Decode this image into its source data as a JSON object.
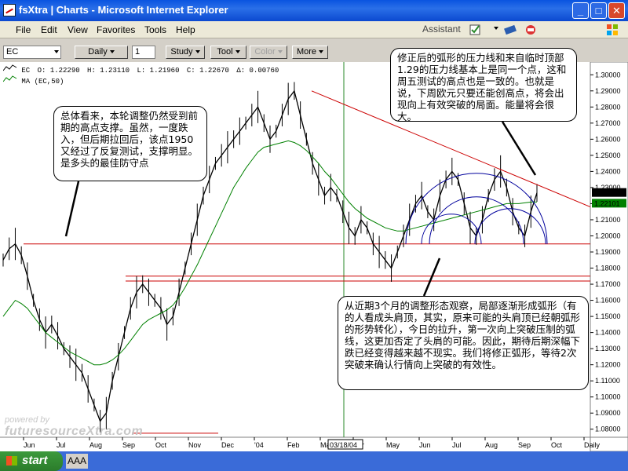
{
  "window": {
    "title": "fsXtra | Charts - Microsoft Internet Explorer",
    "controls": {
      "minimize": "_",
      "maximize": "□",
      "close": "✕"
    }
  },
  "menu": {
    "items": [
      "File",
      "Edit",
      "View",
      "Favorites",
      "Tools",
      "Help"
    ],
    "assistant": "Assistant"
  },
  "toolbar": {
    "symbol": "EC",
    "period": "Daily",
    "count": "1",
    "study": "Study",
    "tool": "Tool",
    "color": "Color",
    "more": "More"
  },
  "legend": {
    "row1": {
      "symbol": "EC",
      "open": "O: 1.22290",
      "high": "H: 1.23110",
      "low": "L: 1.21960",
      "close": "C: 1.22670",
      "change": "Δ: 0.00760"
    },
    "row2": {
      "label": "MA (EC,50)"
    }
  },
  "watermark": {
    "line1": "powered by",
    "line2": "futuresourceXtra.com"
  },
  "annotations": {
    "top_right": "修正后的弧形的压力线和来自临时顶部1.29的压力线基本上是同一个点，这和周五测试的高点也是一致的。也就是说，下周欧元只要还能创高点，将会出现向上有效突破的局面。能量将会很大。",
    "left": "总体看来，本轮调整仍然受到前期的高点支撑。虽然，一度跌入，但后期拉回后，该点1950又经过了反复测试，支撑明显。是多头的最佳防守点",
    "bottom_right": "从近期3个月的调整形态观察，局部逐渐形成弧形（有的人看成头肩顶，其实，原来可能的头肩顶已经朝弧形的形势转化），今日的拉升，第一次向上突破压制的弧线，这更加否定了头肩的可能。因此，期待后期深幅下跌已经变得越来越不现实。我们将修正弧形，等待2次突破来确认行情向上突破的有效性。"
  },
  "chart_data": {
    "type": "line",
    "symbol": "EC",
    "x_tick_labels": [
      "Jun",
      "Jul",
      "Aug",
      "Sep",
      "Oct",
      "Nov",
      "Dec",
      "'04",
      "Feb",
      "Mar",
      "Apr",
      "May",
      "Jun",
      "Jul",
      "Aug",
      "Sep",
      "Oct",
      "Daily"
    ],
    "highlighted_date": "03/18/04",
    "y_tick_labels": [
      "1.30000",
      "1.29000",
      "1.28000",
      "1.27000",
      "1.26000",
      "1.25000",
      "1.24000",
      "1.23000",
      "1.22000",
      "1.21000",
      "1.20000",
      "1.19000",
      "1.18000",
      "1.17000",
      "1.16000",
      "1.15000",
      "1.14000",
      "1.13000",
      "1.12000",
      "1.11000",
      "1.10000",
      "1.09000",
      "1.08000"
    ],
    "ylim": [
      1.075,
      1.305
    ],
    "last_price_tags": {
      "close": "1.22670",
      "ma": "1.22101"
    },
    "series": [
      {
        "name": "EC",
        "color": "#000000",
        "close": [
          1.185,
          1.192,
          1.195,
          1.188,
          1.175,
          1.16,
          1.148,
          1.14,
          1.145,
          1.138,
          1.13,
          1.125,
          1.12,
          1.115,
          1.105,
          1.095,
          1.085,
          1.09,
          1.11,
          1.125,
          1.14,
          1.155,
          1.165,
          1.17,
          1.165,
          1.16,
          1.155,
          1.145,
          1.15,
          1.165,
          1.18,
          1.195,
          1.21,
          1.225,
          1.235,
          1.245,
          1.25,
          1.255,
          1.26,
          1.265,
          1.27,
          1.275,
          1.28,
          1.27,
          1.26,
          1.265,
          1.275,
          1.285,
          1.29,
          1.275,
          1.26,
          1.245,
          1.235,
          1.225,
          1.23,
          1.225,
          1.215,
          1.205,
          1.2,
          1.21,
          1.205,
          1.195,
          1.19,
          1.185,
          1.18,
          1.19,
          1.2,
          1.21,
          1.22,
          1.225,
          1.215,
          1.21,
          1.225,
          1.235,
          1.24,
          1.235,
          1.22,
          1.205,
          1.2,
          1.21,
          1.225,
          1.235,
          1.24,
          1.23,
          1.215,
          1.205,
          1.2,
          1.215,
          1.2267
        ]
      },
      {
        "name": "MA (EC,50)",
        "color": "#008000",
        "close": [
          1.15,
          1.155,
          1.16,
          1.158,
          1.155,
          1.15,
          1.145,
          1.14,
          1.137,
          1.134,
          1.131,
          1.128,
          1.126,
          1.124,
          1.122,
          1.12,
          1.12,
          1.121,
          1.123,
          1.126,
          1.13,
          1.135,
          1.14,
          1.145,
          1.148,
          1.15,
          1.152,
          1.154,
          1.157,
          1.162,
          1.168,
          1.175,
          1.182,
          1.19,
          1.198,
          1.206,
          1.214,
          1.222,
          1.23,
          1.236,
          1.242,
          1.247,
          1.252,
          1.255,
          1.256,
          1.257,
          1.258,
          1.259,
          1.258,
          1.256,
          1.253,
          1.249,
          1.245,
          1.24,
          1.236,
          1.231,
          1.226,
          1.221,
          1.217,
          1.214,
          1.211,
          1.209,
          1.207,
          1.205,
          1.204,
          1.203,
          1.203,
          1.204,
          1.205,
          1.206,
          1.207,
          1.208,
          1.209,
          1.21,
          1.211,
          1.212,
          1.213,
          1.214,
          1.215,
          1.216,
          1.217,
          1.218,
          1.219,
          1.22,
          1.22,
          1.22,
          1.2205,
          1.221,
          1.22101
        ]
      }
    ],
    "support_lines": [
      1.195,
      1.175,
      1.172
    ],
    "resistance_trendline": {
      "from_date": "Feb",
      "from_value": 1.29,
      "to_value": 1.22
    },
    "colors": {
      "price": "#000000",
      "ma": "#008000",
      "trendline": "#cc0000",
      "arcs": "#00009c",
      "support": "#cc0000"
    }
  },
  "taskbar": {
    "start_label": "start",
    "status_text": "AAA"
  }
}
